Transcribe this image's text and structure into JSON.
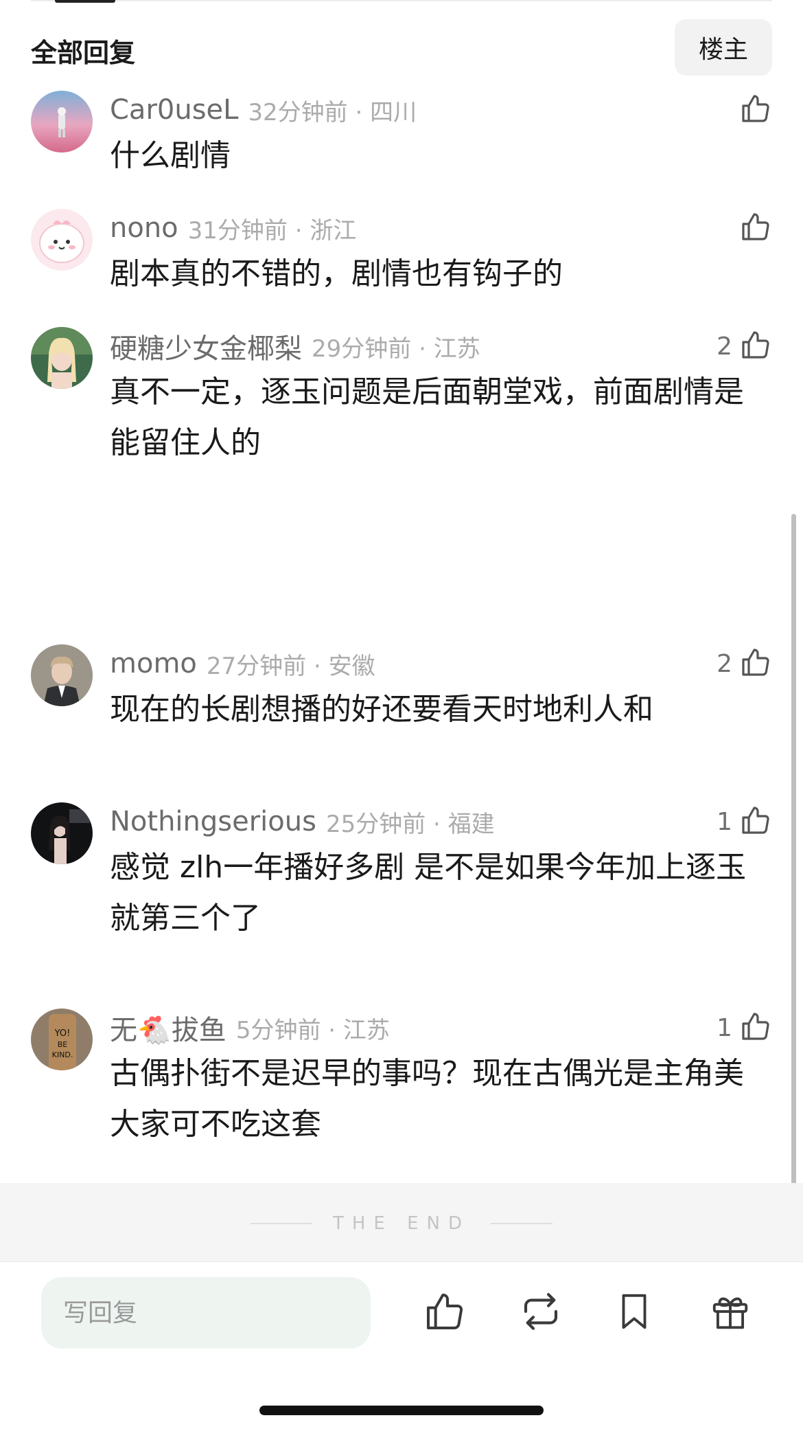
{
  "header": {
    "title": "全部回复",
    "op_button": "楼主"
  },
  "comments": [
    {
      "username": "Car0useL",
      "time": "32分钟前",
      "location": "四川",
      "text": "什么剧情",
      "likes": ""
    },
    {
      "username": "nono",
      "time": "31分钟前",
      "location": "浙江",
      "text": "剧本真的不错的，剧情也有钩子的",
      "likes": ""
    },
    {
      "username": "硬糖少女金椰梨",
      "time": "29分钟前",
      "location": "江苏",
      "text": "真不一定，逐玉问题是后面朝堂戏，前面剧情是能留住人的",
      "likes": "2"
    },
    {
      "username": "momo",
      "time": "27分钟前",
      "location": "安徽",
      "text": "现在的长剧想播的好还要看天时地利人和",
      "likes": "2"
    },
    {
      "username": "Nothingserious",
      "time": "25分钟前",
      "location": "福建",
      "text": "感觉 zlh一年播好多剧 是不是如果今年加上逐玉就第三个了",
      "likes": "1"
    },
    {
      "username": "无🐔拔鱼",
      "time": "5分钟前",
      "location": "江苏",
      "text": "古偶扑街不是迟早的事吗？现在古偶光是主角美大家可不吃这套",
      "likes": "1"
    }
  ],
  "separator": " · ",
  "footer": {
    "end_text": "THE END"
  },
  "bottom_bar": {
    "reply_placeholder": "写回复"
  },
  "avatar_text": {
    "yoi": "YO!",
    "be": "BE",
    "kind": "KIND."
  },
  "icons": {
    "like": "thumbs-up-icon",
    "repost": "repost-icon",
    "favorite": "bookmark-icon",
    "gift": "gift-icon"
  },
  "colors": {
    "reply_box": "#eef5f1",
    "username": "#6b6b6b",
    "meta": "#ababab"
  }
}
